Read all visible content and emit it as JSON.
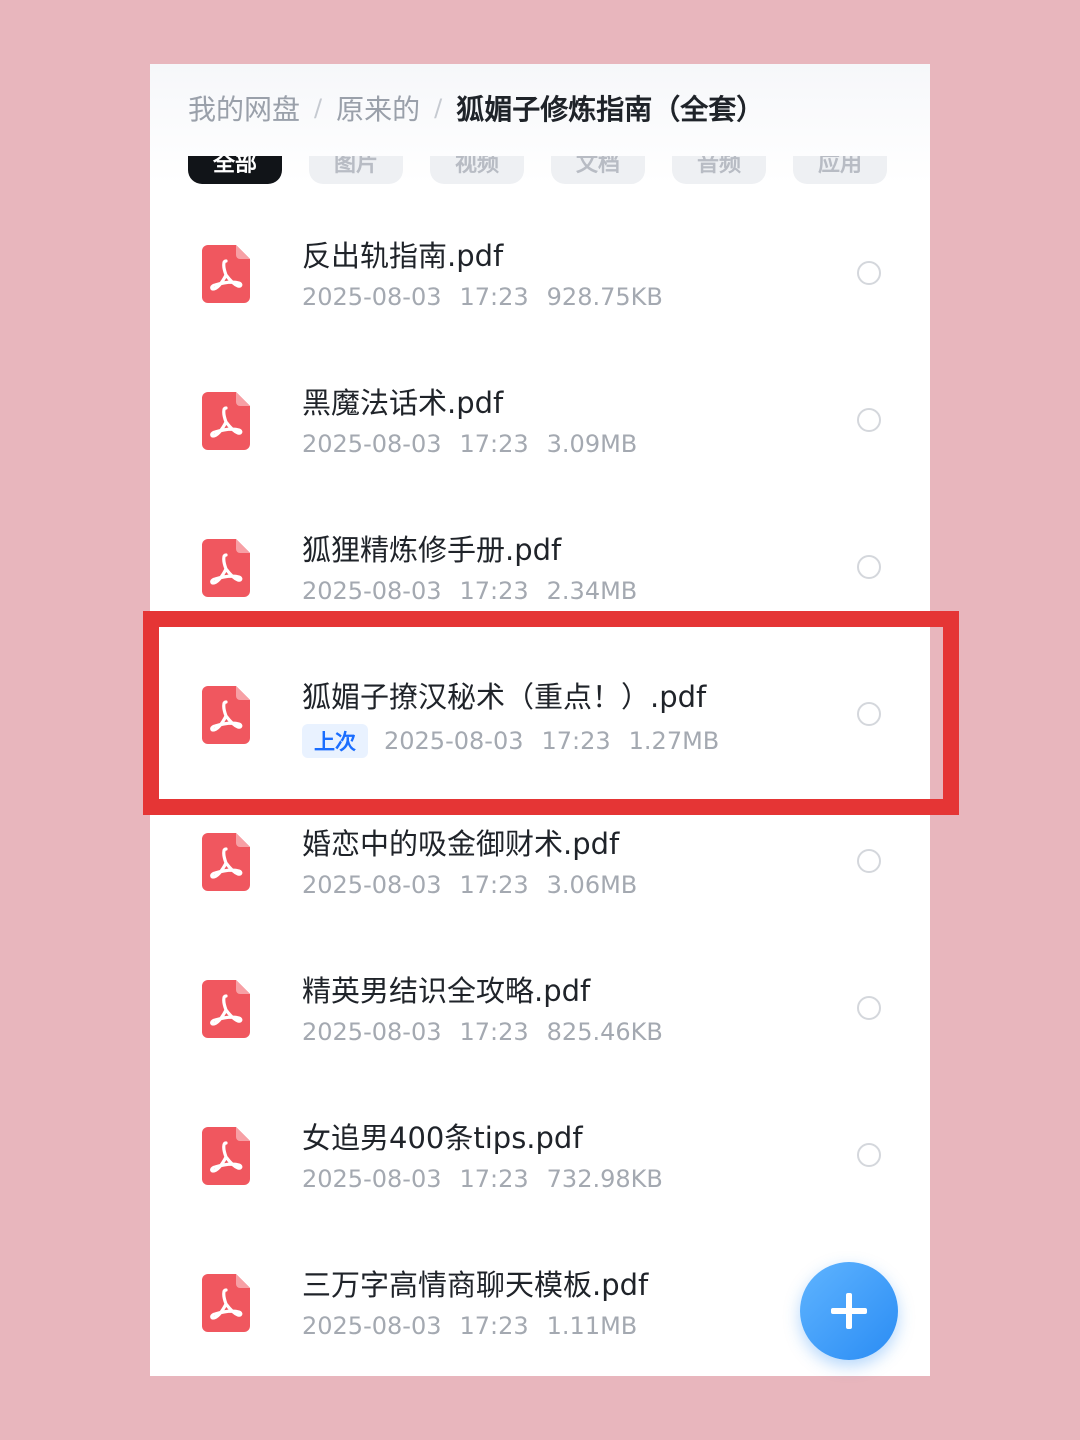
{
  "breadcrumb": {
    "root": "我的网盘",
    "parent": "原来的",
    "current": "狐媚子修炼指南（全套）",
    "separator": "/"
  },
  "tabs": [
    {
      "label": "全部",
      "active": true
    },
    {
      "label": "图片",
      "active": false
    },
    {
      "label": "视频",
      "active": false
    },
    {
      "label": "文档",
      "active": false
    },
    {
      "label": "音频",
      "active": false
    },
    {
      "label": "应用",
      "active": false
    }
  ],
  "files": [
    {
      "name": "反出轨指南.pdf",
      "badge": "",
      "date": "2025-08-03",
      "time": "17:23",
      "size": "928.75KB",
      "icon": "pdf-icon"
    },
    {
      "name": "黑魔法话术.pdf",
      "badge": "",
      "date": "2025-08-03",
      "time": "17:23",
      "size": "3.09MB",
      "icon": "pdf-icon"
    },
    {
      "name": "狐狸精炼修手册.pdf",
      "badge": "",
      "date": "2025-08-03",
      "time": "17:23",
      "size": "2.34MB",
      "icon": "pdf-icon"
    },
    {
      "name": "狐媚子撩汉秘术（重点！）.pdf",
      "badge": "上次",
      "date": "2025-08-03",
      "time": "17:23",
      "size": "1.27MB",
      "icon": "pdf-icon"
    },
    {
      "name": "婚恋中的吸金御财术.pdf",
      "badge": "",
      "date": "2025-08-03",
      "time": "17:23",
      "size": "3.06MB",
      "icon": "pdf-icon"
    },
    {
      "name": "精英男结识全攻略.pdf",
      "badge": "",
      "date": "2025-08-03",
      "time": "17:23",
      "size": "825.46KB",
      "icon": "pdf-icon"
    },
    {
      "name": "女追男400条tips.pdf",
      "badge": "",
      "date": "2025-08-03",
      "time": "17:23",
      "size": "732.98KB",
      "icon": "pdf-icon"
    },
    {
      "name": "三万字高情商聊天模板.pdf",
      "badge": "",
      "date": "2025-08-03",
      "time": "17:23",
      "size": "1.11MB",
      "icon": "pdf-icon"
    }
  ],
  "colors": {
    "background": "#e8b6bd",
    "pdf_icon": "#f0575f",
    "highlight_border": "#e53535",
    "badge_text": "#1a6dff",
    "fab": "#2a8cf4"
  },
  "fab": {
    "icon": "plus-icon"
  }
}
